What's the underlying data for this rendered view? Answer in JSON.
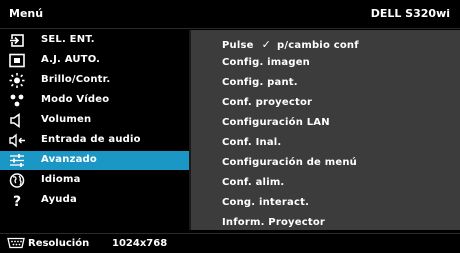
{
  "header": {
    "title": "Menú",
    "model": "DELL S320wi"
  },
  "menu": {
    "items": [
      {
        "label": "SEL. ENT.",
        "icon": "input-select-icon"
      },
      {
        "label": "A.J. AUTO.",
        "icon": "auto-adjust-icon"
      },
      {
        "label": "Brillo/Contr.",
        "icon": "brightness-icon"
      },
      {
        "label": "Modo Vídeo",
        "icon": "video-mode-icon"
      },
      {
        "label": "Volumen",
        "icon": "speaker-icon"
      },
      {
        "label": "Entrada de audio",
        "icon": "audio-input-icon"
      },
      {
        "label": "Avanzado",
        "icon": "sliders-icon",
        "selected": true
      },
      {
        "label": "Idioma",
        "icon": "globe-icon"
      },
      {
        "label": "Ayuda",
        "icon": "question-icon"
      }
    ]
  },
  "submenu": {
    "pulse_label": "Pulse",
    "pulse_suffix": "p/cambio conf",
    "items": [
      "Config. imagen",
      "Config. pant.",
      "Conf. proyector",
      "Configuración LAN",
      "Conf. Inal.",
      "Configuración de menú",
      "Conf. alim.",
      "Cong. interact.",
      "Inform. Proyector"
    ]
  },
  "status": {
    "resolution_label": "Resolución",
    "resolution_value": "1024x768"
  },
  "colors": {
    "highlight": "#1b97c5",
    "submenu_bg": "#3c3c3c",
    "background": "#000000"
  }
}
